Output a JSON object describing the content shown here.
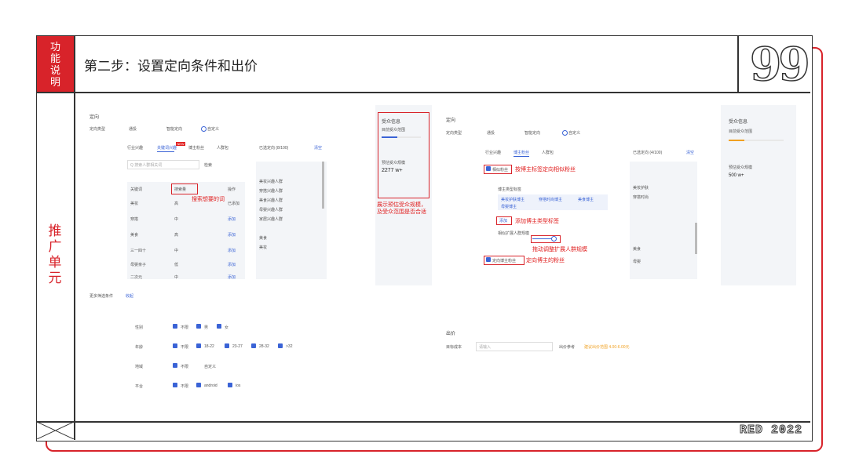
{
  "colors": {
    "accent": "#d8232a",
    "blue": "#3a63d6"
  },
  "side": {
    "top_label": "功能说明",
    "section_label": "推广单元"
  },
  "title": "第二步：设置定向条件和出价",
  "brand": {
    "quote_glyph": "99",
    "footer": "RED 2022"
  },
  "left_shot": {
    "section": "定向",
    "type_label": "定向类型",
    "type_opts": [
      "通投",
      "智能定向",
      "自定义"
    ],
    "tabs": [
      "行业兴趣",
      "关键词兴趣",
      "博主粉丝",
      "人群包"
    ],
    "tab_badge": "NEW",
    "search_placeholder": "Q 搜索人群相关词",
    "search_btn": "检索",
    "rows": [
      [
        "关键词",
        "搜索量",
        "操作"
      ],
      [
        "美妆",
        "高",
        "已添加"
      ],
      [
        "穿搭",
        "中",
        "添加"
      ],
      [
        "美食",
        "高",
        "添加"
      ],
      [
        "三一四十",
        "中",
        "添加"
      ],
      [
        "母婴亲子",
        "低",
        "添加"
      ],
      [
        "二次元",
        "中",
        "添加"
      ]
    ],
    "selected_title": "已选定向 (8/100)",
    "clear": "清空",
    "selected_items": [
      "美妆兴趣人群",
      "穿搭兴趣人群",
      "美食兴趣人群",
      "母婴兴趣人群",
      "家居兴趣人群",
      "美食",
      "美妆"
    ],
    "note_search": "搜索想要的词",
    "more_label": "更多筛选条件",
    "more_link": "收起",
    "gender_label": "性别",
    "gender": [
      "不限",
      "男",
      "女"
    ],
    "age_label": "年龄",
    "age": [
      "不限",
      "18-22",
      "23-27",
      "28-32",
      ">32"
    ],
    "region_label": "地域",
    "region": [
      "不限",
      "自定义"
    ],
    "platform_label": "平台",
    "platform": [
      "不限",
      "android",
      "ios"
    ]
  },
  "audience_left": {
    "title": "受众信息",
    "range": "目前受众范围",
    "est_label": "预估受众规模",
    "est_value": "2277 w+"
  },
  "note_left": {
    "line1": "展示预估受众规模，",
    "line2": "及受众范围是否合适"
  },
  "right_shot": {
    "section": "定向",
    "type_label": "定向类型",
    "type_opts": [
      "通投",
      "智能定向",
      "自定义"
    ],
    "tabs": [
      "行业兴趣",
      "博主粉丝",
      "人群包"
    ],
    "fan_label": "相似粉丝",
    "fan_note": "按博主标签定向相似粉丝",
    "bloggers_label": "博主类型标签",
    "tags": [
      "美妆护肤博主",
      "穿搭时尚博主",
      "美食博主",
      "母婴博主"
    ],
    "add_tag": "添加",
    "add_tag_note": "添加博主类型标签",
    "slider_label": "相似扩展人群规模",
    "slider_note": "拖动调整扩展人群规模",
    "target_label": "定向博主粉丝",
    "target_note": "定向博主的粉丝",
    "selected_title": "已选定向 (4/100)",
    "clear": "清空",
    "selected_items": [
      "美妆护肤",
      "穿搭时尚",
      "美食",
      "母婴"
    ],
    "bid_section": "出价",
    "bid_label": "目标成本",
    "bid_placeholder": "请输入",
    "bid_hint": "出价参考",
    "bid_range": "建议出价范围 4.00-6.00元"
  },
  "audience_right": {
    "title": "受众信息",
    "range": "目前受众范围",
    "est_label": "预估受众规模",
    "est_value": "500 w+"
  }
}
